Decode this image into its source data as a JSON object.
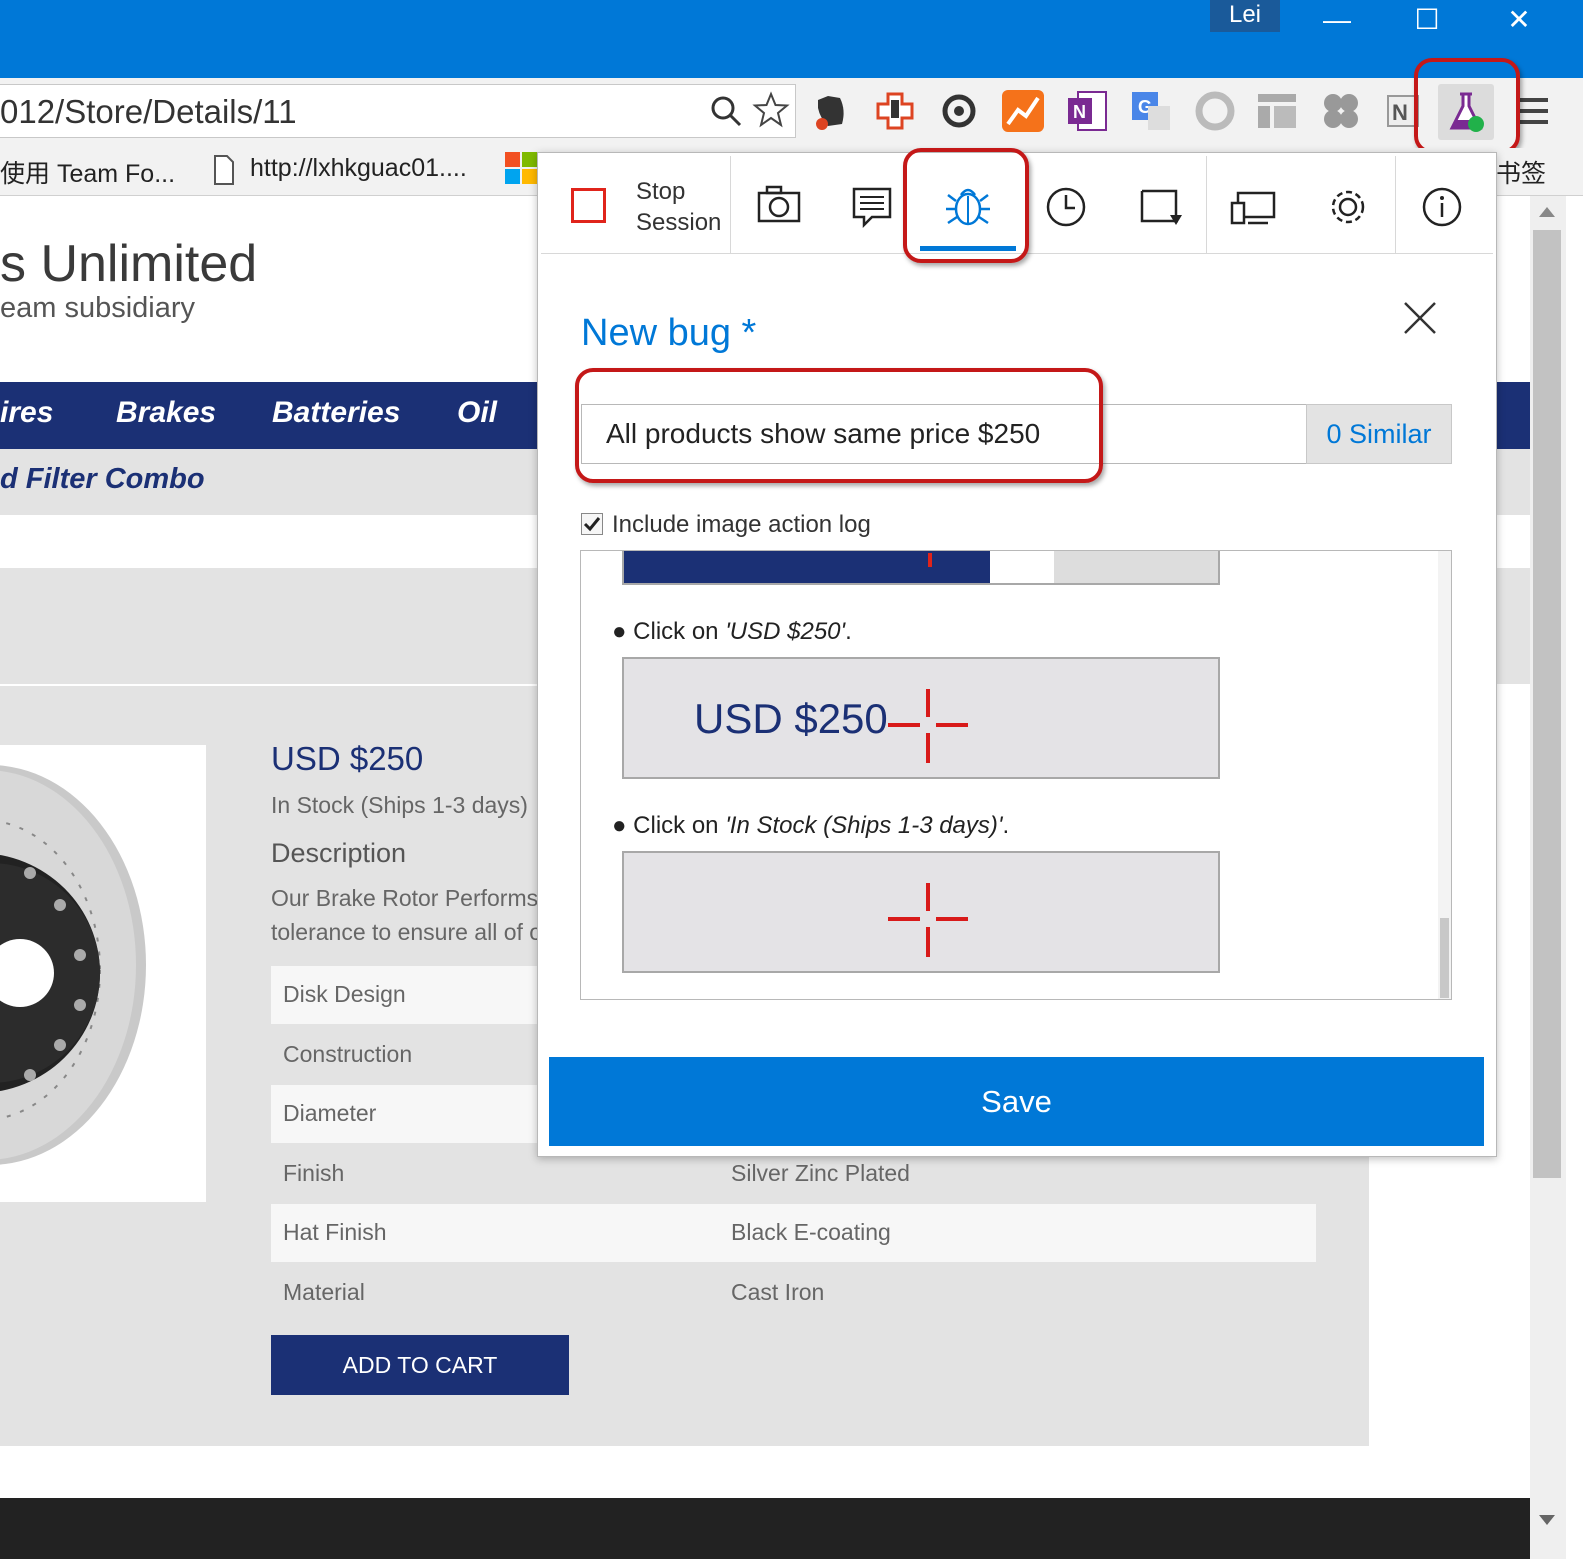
{
  "window": {
    "user": "Lei"
  },
  "browser": {
    "url": "012/Store/Details/11",
    "bookmarks": [
      {
        "label": "使用 Team Fo..."
      },
      {
        "label": "http://lxhkguac01...."
      }
    ],
    "bookmarks_right": "书签"
  },
  "page": {
    "brand": "s Unlimited",
    "brand_sub": "eam subsidiary",
    "categories": [
      "ires",
      "Brakes",
      "Batteries",
      "Oil"
    ],
    "subnav": "d Filter Combo",
    "product": {
      "price": "USD $250",
      "stock": "In Stock (Ships 1-3 days)",
      "description_heading": "Description",
      "description_lines": [
        "Our Brake Rotor Performs v",
        "tolerance to ensure all of o"
      ],
      "specs": [
        {
          "label": "Disk Design",
          "value": ""
        },
        {
          "label": "Construction",
          "value": ""
        },
        {
          "label": "Diameter",
          "value": ""
        },
        {
          "label": "Finish",
          "value": "Silver Zinc Plated"
        },
        {
          "label": "Hat Finish",
          "value": "Black E-coating"
        },
        {
          "label": "Material",
          "value": "Cast Iron"
        }
      ],
      "add_to_cart": "ADD TO CART"
    }
  },
  "popup": {
    "stop_session": {
      "line1": "Stop",
      "line2": "Session"
    },
    "tools": [
      "camera-icon",
      "note-icon",
      "bug-icon",
      "clock-icon",
      "crop-icon",
      "devices-icon",
      "gear-icon",
      "info-icon"
    ],
    "active_tool": "bug-icon",
    "title": "New bug *",
    "bug_title_value": "All products show same price $250",
    "similar": "0 Similar",
    "include_log_label": "Include image action log",
    "include_log_checked": true,
    "log_items": [
      {
        "prefix": "Click on ",
        "target": "'USD $250'",
        "suffix": ".",
        "thumb_text": "USD $250"
      },
      {
        "prefix": "Click on ",
        "target": "'In Stock (Ships 1-3 days)'",
        "suffix": ".",
        "thumb_text": ""
      }
    ],
    "save": "Save"
  },
  "colors": {
    "accent": "#0078d7",
    "nav": "#1b3075",
    "highlight": "#c41818"
  }
}
